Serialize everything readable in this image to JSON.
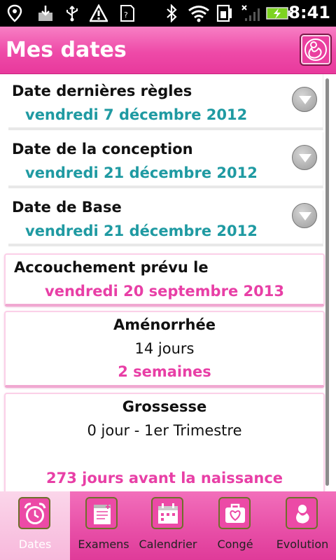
{
  "status_bar": {
    "time": "8:41",
    "icons": [
      "location-icon",
      "download-icon",
      "usb-icon",
      "warning-icon",
      "sd-card-icon",
      "bluetooth-icon",
      "wifi-icon",
      "phone-storage-icon",
      "no-signal-icon",
      "battery-charging-icon"
    ]
  },
  "header": {
    "title": "Mes dates",
    "logo_icon": "pregnancy-logo-icon"
  },
  "dates": [
    {
      "label": "Date dernières règles",
      "value": "vendredi 7 décembre 2012"
    },
    {
      "label": "Date de la conception",
      "value": "vendredi 21 décembre 2012"
    },
    {
      "label": "Date de Base",
      "value": "vendredi 21 décembre 2012"
    }
  ],
  "accouchement": {
    "label": "Accouchement prévu le",
    "value": "vendredi 20 septembre 2013"
  },
  "amenorrhee": {
    "title": "Aménorrhée",
    "days": "14 jours",
    "weeks": "2 semaines"
  },
  "grossesse": {
    "title": "Grossesse",
    "detail": "0 jour - 1er Trimestre",
    "countdown": "273 jours avant la naissance"
  },
  "tabs": [
    {
      "label": "Dates",
      "icon": "alarm-clock-icon",
      "active": true
    },
    {
      "label": "Examens",
      "icon": "notepad-icon",
      "active": false
    },
    {
      "label": "Calendrier",
      "icon": "calendar-icon",
      "active": false
    },
    {
      "label": "Congé",
      "icon": "heart-bag-icon",
      "active": false
    },
    {
      "label": "Evolution",
      "icon": "fetus-icon",
      "active": false
    }
  ],
  "colors": {
    "accent_pink": "#e83fa6",
    "teal": "#1f9aa2",
    "header_pink": "#ee4aa8"
  }
}
